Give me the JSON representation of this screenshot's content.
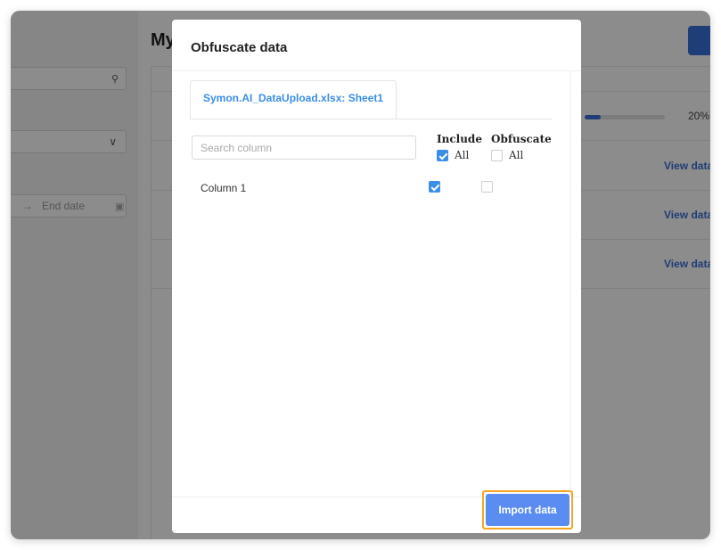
{
  "background": {
    "page_title": "My",
    "search_icon": "🔍",
    "select_chevron": "∨",
    "date_arrow": "→",
    "date_placeholder": "End date",
    "calendar_icon": "▣",
    "progress_value_percent": 20,
    "progress_label": "20%",
    "view_links": [
      "View data",
      "View data",
      "View data"
    ]
  },
  "modal": {
    "title": "Obfuscate data",
    "tab_label": "Symon.AI_DataUpload.xlsx: Sheet1",
    "search_placeholder": "Search column",
    "include_header": "Include",
    "obfuscate_header": "Obfuscate",
    "include_all_label": "All",
    "obfuscate_all_label": "All",
    "include_all_checked": true,
    "obfuscate_all_checked": false,
    "columns": [
      {
        "name": "Column 1",
        "include": true,
        "obfuscate": false
      }
    ],
    "import_button_label": "Import data"
  },
  "colors": {
    "accent": "#3a8ee6",
    "button": "#5b8cf2",
    "highlight": "#f5a623"
  }
}
